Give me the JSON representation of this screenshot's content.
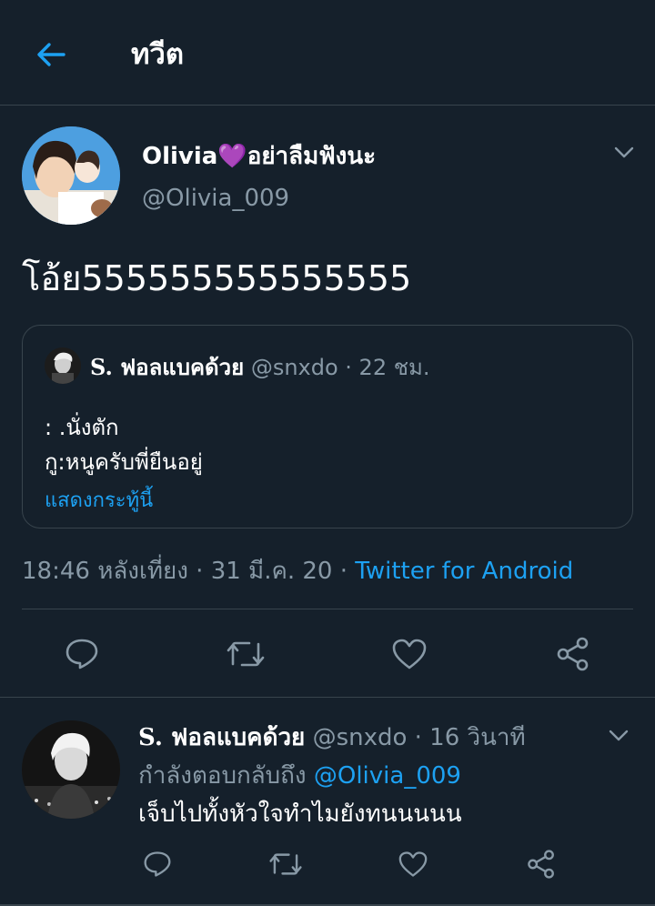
{
  "colors": {
    "background": "#15202b",
    "accent": "#1da1f2",
    "muted_text": "#8899a6",
    "border": "#38444d",
    "text": "#ffffff"
  },
  "header": {
    "title": "ทวีต",
    "back_icon": "arrow-left-icon"
  },
  "main_tweet": {
    "display_name": "Olivia💜อย่าลืมฟังนะ",
    "handle": "@Olivia_009",
    "text": "โอ้ย555555555555555",
    "quoted": {
      "display_name": "S. ฟอลแบคด้วย",
      "handle_time": "@snxdo · 22 ชม.",
      "line1": ": .นั่งตัก",
      "line2": "กู:หนูครับพี่ยืนอยู่",
      "show_thread": "แสดงกระทู้นี้"
    },
    "timestamp": "18:46 หลังเที่ยง · 31 มี.ค. 20 · ",
    "source": "Twitter for Android",
    "actions": [
      "reply-icon",
      "retweet-icon",
      "like-icon",
      "share-icon"
    ]
  },
  "reply_tweet": {
    "display_name": "S. ฟอลแบคด้วย",
    "handle_time": "@snxdo · 16 วินาที",
    "replying_prefix": "กำลังตอบกลับถึง ",
    "replying_handle": "@Olivia_009",
    "text": "เจ็บไปทั้งหัวใจทำไมยังทนนนนน",
    "actions": [
      "reply-icon",
      "retweet-icon",
      "like-icon",
      "share-icon"
    ]
  }
}
